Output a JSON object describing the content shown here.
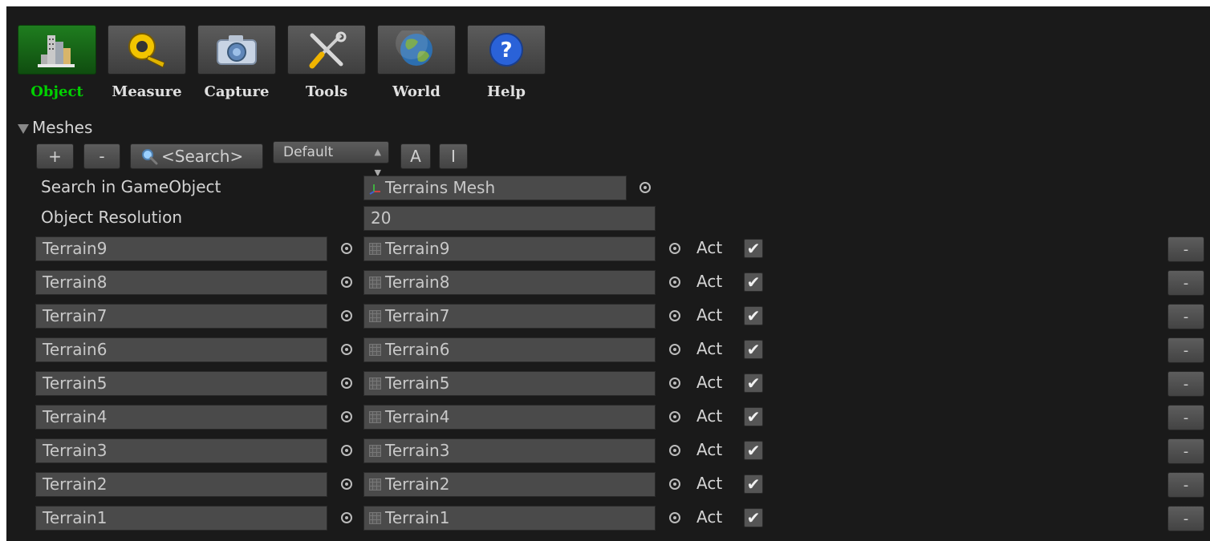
{
  "toolbar": {
    "tabs": [
      {
        "label": "Object",
        "icon": "buildings-icon",
        "active": true
      },
      {
        "label": "Measure",
        "icon": "tape-measure-icon",
        "active": false
      },
      {
        "label": "Capture",
        "icon": "camera-icon",
        "active": false
      },
      {
        "label": "Tools",
        "icon": "wrench-screwdriver-icon",
        "active": false
      },
      {
        "label": "World",
        "icon": "globe-icon",
        "active": false
      },
      {
        "label": "Help",
        "icon": "help-icon",
        "active": false
      }
    ]
  },
  "meshes": {
    "section_title": "Meshes",
    "add_label": "+",
    "remove_label": "-",
    "search_label": "<Search>",
    "sort_mode": "Default",
    "btn_a_label": "A",
    "btn_i_label": "I",
    "search_in_label": "Search in GameObject",
    "search_in_value": "Terrains Mesh",
    "resolution_label": "Object Resolution",
    "resolution_value": "20",
    "rows": [
      {
        "name": "Terrain9",
        "object": "Terrain9",
        "act_label": "Act",
        "checked": true,
        "remove": "-"
      },
      {
        "name": "Terrain8",
        "object": "Terrain8",
        "act_label": "Act",
        "checked": true,
        "remove": "-"
      },
      {
        "name": "Terrain7",
        "object": "Terrain7",
        "act_label": "Act",
        "checked": true,
        "remove": "-"
      },
      {
        "name": "Terrain6",
        "object": "Terrain6",
        "act_label": "Act",
        "checked": true,
        "remove": "-"
      },
      {
        "name": "Terrain5",
        "object": "Terrain5",
        "act_label": "Act",
        "checked": true,
        "remove": "-"
      },
      {
        "name": "Terrain4",
        "object": "Terrain4",
        "act_label": "Act",
        "checked": true,
        "remove": "-"
      },
      {
        "name": "Terrain3",
        "object": "Terrain3",
        "act_label": "Act",
        "checked": true,
        "remove": "-"
      },
      {
        "name": "Terrain2",
        "object": "Terrain2",
        "act_label": "Act",
        "checked": true,
        "remove": "-"
      },
      {
        "name": "Terrain1",
        "object": "Terrain1",
        "act_label": "Act",
        "checked": true,
        "remove": "-"
      }
    ]
  }
}
